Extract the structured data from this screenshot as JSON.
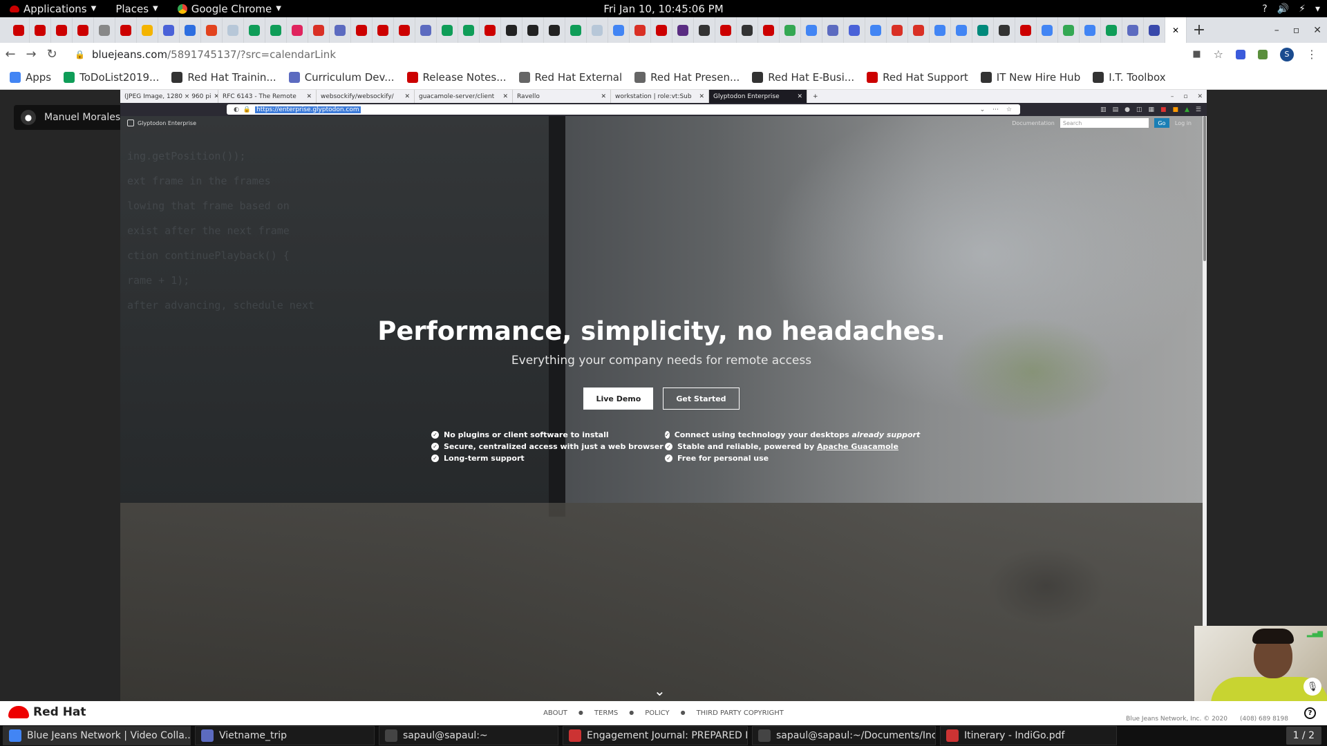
{
  "gnome_bar": {
    "applications": "Applications",
    "places": "Places",
    "chrome_menu": "Google Chrome",
    "clock": "Fri Jan 10, 10:45:06 PM",
    "tray": [
      "?",
      "🔊",
      "⚡",
      "▾"
    ]
  },
  "chrome": {
    "pinned_tab_colors": [
      "#cc0000",
      "#cc0000",
      "#cc0000",
      "#cc0000",
      "#888888",
      "#cc0000",
      "#f4b400",
      "#4a62d8",
      "#2d6ee0",
      "#e2431e",
      "#b7c7d8",
      "#0f9d58",
      "#0f9d58",
      "#e0245e",
      "#d93025",
      "#5c6bc0",
      "#cc0000",
      "#cc0000",
      "#cc0000",
      "#5c6bc0",
      "#0f9d58",
      "#0f9d58",
      "#cc0000",
      "#222222",
      "#222222",
      "#222222",
      "#0f9d58",
      "#b7c7d8",
      "#4285f4",
      "#d93025",
      "#cc0000",
      "#5a2d82",
      "#333333",
      "#cc0000",
      "#333333",
      "#cc0000",
      "#34a853",
      "#4285f4",
      "#5c6bc0",
      "#4a62d8",
      "#4285f4",
      "#d93025",
      "#d93025",
      "#4285f4",
      "#4285f4",
      "#00897b",
      "#333333",
      "#cc0000",
      "#4285f4",
      "#34a853",
      "#4285f4",
      "#0f9d58",
      "#5c6bc0",
      "#3949ab"
    ],
    "new_tab": "+",
    "window_controls": [
      "–",
      "▫",
      "✕"
    ],
    "url_host": "bluejeans.com",
    "url_path": "/5891745137/?src=calendarLink",
    "profile_initial": "S"
  },
  "bookmarks": [
    {
      "label": "Apps",
      "color": "#4285f4"
    },
    {
      "label": "ToDoList2019...",
      "color": "#0f9d58"
    },
    {
      "label": "Red Hat Trainin...",
      "color": "#333333"
    },
    {
      "label": "Curriculum Dev...",
      "color": "#5c6bc0"
    },
    {
      "label": "Release Notes...",
      "color": "#cc0000"
    },
    {
      "label": "Red Hat External",
      "color": "#666666"
    },
    {
      "label": "Red Hat Presen...",
      "color": "#666666"
    },
    {
      "label": "Red Hat E-Busi...",
      "color": "#333333"
    },
    {
      "label": "Red Hat Support",
      "color": "#cc0000"
    },
    {
      "label": "IT New Hire Hub",
      "color": "#333333"
    },
    {
      "label": "I.T. Toolbox",
      "color": "#333333"
    }
  ],
  "bluejeans": {
    "talking_text": "Manuel Morales is talking",
    "footer_links": [
      "ABOUT",
      "TERMS",
      "POLICY",
      "THIRD PARTY COPYRIGHT"
    ],
    "copyright": "Blue Jeans Network, Inc. © 2020",
    "phone": "(408) 689 8198",
    "redhat_label": "Red Hat",
    "help": "?"
  },
  "shared_screen": {
    "firefox_tabs": [
      {
        "title": "(JPEG Image, 1280 × 960 pi",
        "active": false
      },
      {
        "title": "RFC 6143 - The Remote",
        "active": false
      },
      {
        "title": "websockify/websockify/",
        "active": false
      },
      {
        "title": "guacamole-server/client",
        "active": false
      },
      {
        "title": "Ravello",
        "active": false
      },
      {
        "title": "workstation | role:vt:Sub",
        "active": false
      },
      {
        "title": "Glyptodon Enterprise",
        "active": true
      }
    ],
    "url": "https://enterprise.glyptodon.com",
    "site": {
      "logo_text": "Glyptodon Enterprise",
      "nav_documentation": "Documentation",
      "search_placeholder": "Search",
      "go": "Go",
      "login": "Log in",
      "headline": "Performance, simplicity, no headaches.",
      "subheadline": "Everything your company needs for remote access",
      "live_demo": "Live Demo",
      "get_started": "Get Started",
      "features": [
        {
          "text": "No plugins or client software to install"
        },
        {
          "text": "Connect using technology your desktops ",
          "em": "already support"
        },
        {
          "text": "Secure, centralized access with just a web browser"
        },
        {
          "text": "Stable and reliable, powered by ",
          "link": "Apache Guacamole"
        },
        {
          "text": "Long-term support"
        },
        {
          "text": "Free for personal use"
        }
      ],
      "code_lines": [
        "ing.getPosition());",
        "",
        "ext frame in the frames",
        "lowing that frame based on",
        "exist after the next frame",
        "",
        "ction continuePlayback() {",
        "",
        "rame + 1);",
        "",
        "after advancing, schedule next"
      ]
    }
  },
  "taskbar": {
    "items": [
      {
        "label": "Blue Jeans Network | Video Colla...",
        "color": "#4285f4",
        "active": true
      },
      {
        "label": "Vietname_trip",
        "color": "#5c6bc0",
        "active": false
      },
      {
        "label": "sapaul@sapaul:~",
        "color": "#444444",
        "active": false
      },
      {
        "label": "Engagement Journal: PREPARED F...",
        "color": "#cc3333",
        "active": false
      },
      {
        "label": "sapaul@sapaul:~/Documents/Inco...",
        "color": "#444444",
        "active": false
      },
      {
        "label": "Itinerary - IndiGo.pdf",
        "color": "#cc3333",
        "active": false
      }
    ],
    "pager": "1 / 2"
  }
}
